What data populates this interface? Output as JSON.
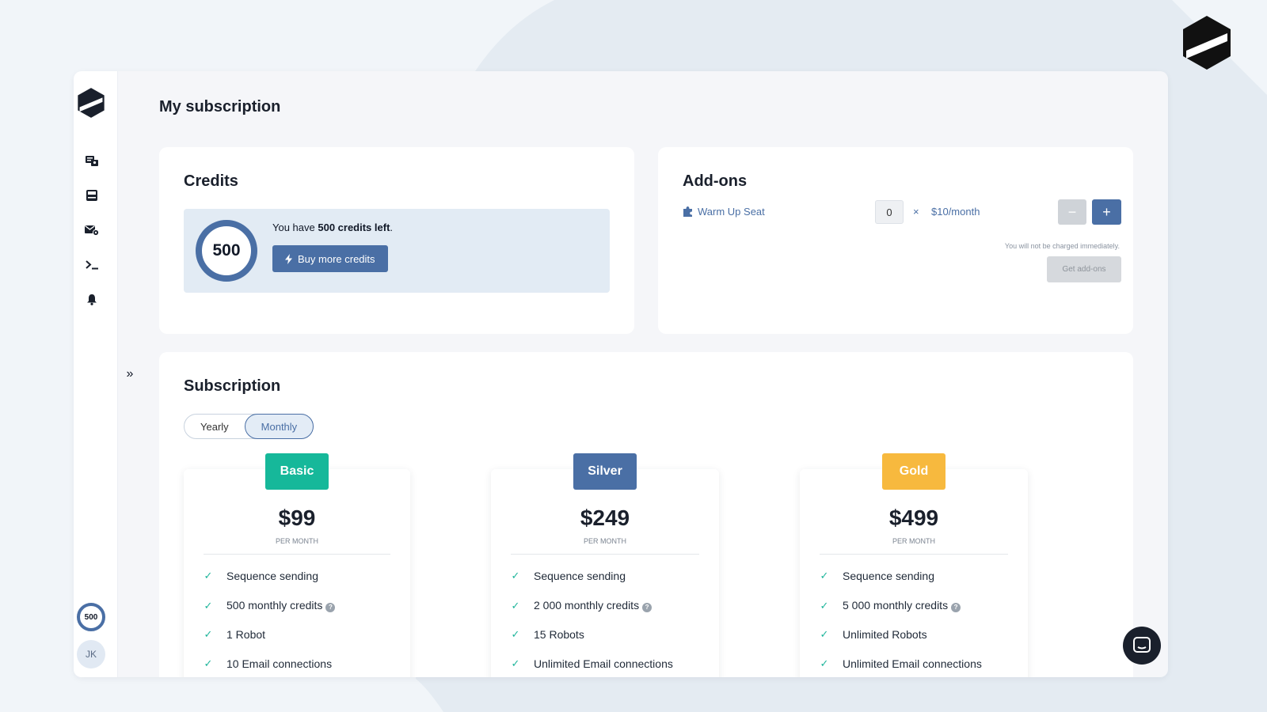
{
  "page": {
    "title": "My subscription"
  },
  "sidebar": {
    "items": [
      {
        "icon": "contacts-icon"
      },
      {
        "icon": "inbox-icon"
      },
      {
        "icon": "email-settings-icon"
      },
      {
        "icon": "terminal-icon"
      },
      {
        "icon": "bell-icon"
      }
    ],
    "credits_badge": "500",
    "avatar_initials": "JK",
    "expand_label": "»"
  },
  "credits": {
    "title": "Credits",
    "ring_value": "500",
    "text_prefix": "You have ",
    "text_bold": "500 credits left",
    "text_suffix": ".",
    "buy_button": "Buy more credits"
  },
  "addons": {
    "title": "Add-ons",
    "item_name": "Warm Up Seat",
    "quantity": "0",
    "times": "×",
    "unit_price": "$10/month",
    "minus": "−",
    "plus": "+",
    "note": "You will not be charged immediately.",
    "get_button": "Get add-ons"
  },
  "subscription": {
    "title": "Subscription",
    "billing_options": [
      "Yearly",
      "Monthly"
    ],
    "selected_billing": "Monthly",
    "plans": [
      {
        "name": "Basic",
        "color": "#16b89a",
        "price": "$99",
        "period": "PER MONTH",
        "features": [
          "Sequence sending",
          "500 monthly credits",
          "1 Robot",
          "10 Email connections"
        ]
      },
      {
        "name": "Silver",
        "color": "#4a6fa5",
        "price": "$249",
        "period": "PER MONTH",
        "features": [
          "Sequence sending",
          "2 000 monthly credits",
          "15 Robots",
          "Unlimited Email connections"
        ]
      },
      {
        "name": "Gold",
        "color": "#f7b93e",
        "price": "$499",
        "period": "PER MONTH",
        "features": [
          "Sequence sending",
          "5 000 monthly credits",
          "Unlimited Robots",
          "Unlimited Email connections"
        ]
      }
    ]
  },
  "colors": {
    "accent": "#4a6fa5",
    "check": "#1fb59b",
    "background": "#f1f5f9"
  }
}
